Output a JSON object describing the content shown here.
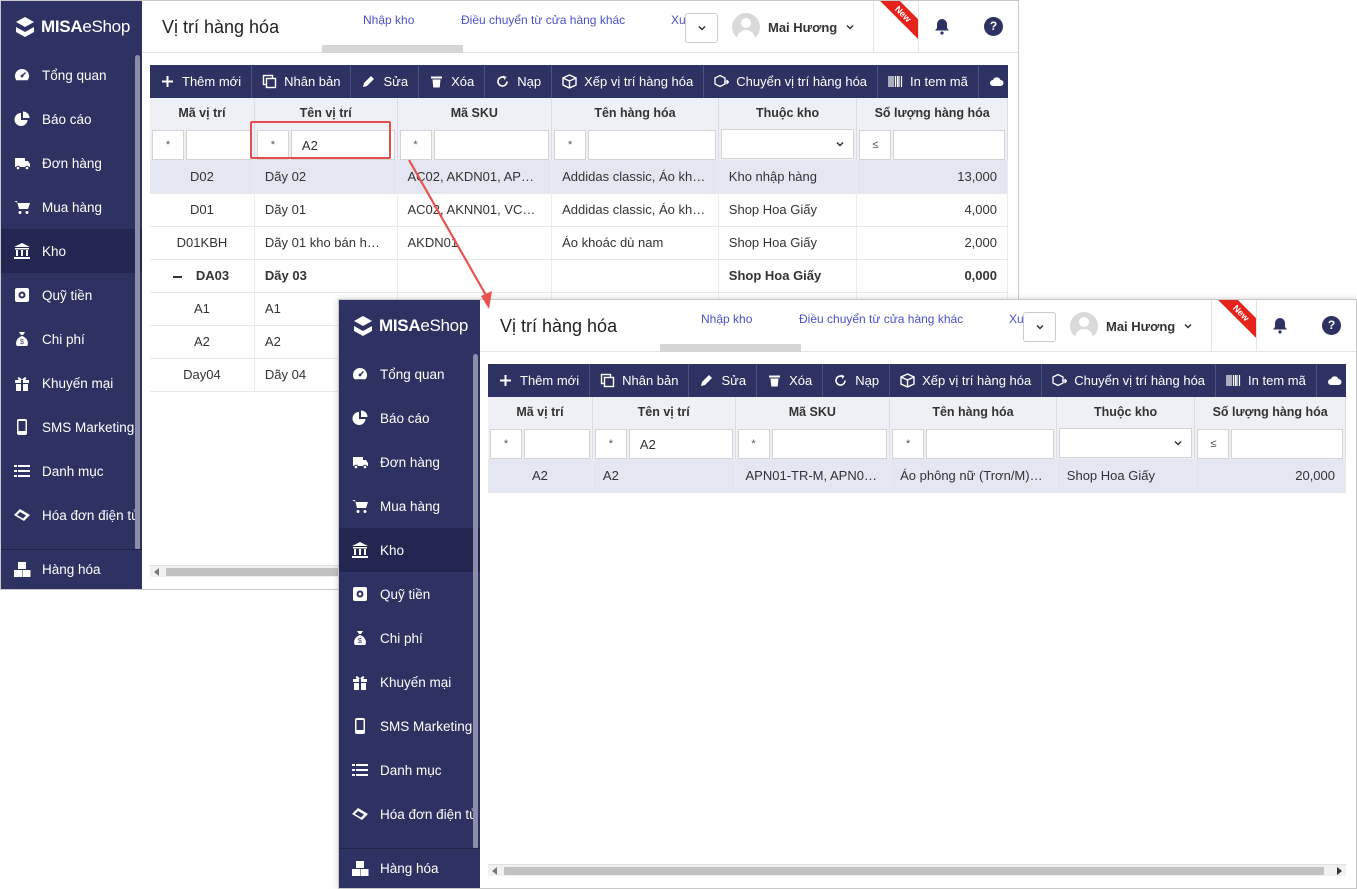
{
  "brand": {
    "bold": "MISA",
    "light": "eShop"
  },
  "sidebar": {
    "items": [
      {
        "label": "Tổng quan",
        "icon": "dashboard-icon"
      },
      {
        "label": "Báo cáo",
        "icon": "pie-chart-icon"
      },
      {
        "label": "Đơn hàng",
        "icon": "truck-icon"
      },
      {
        "label": "Mua hàng",
        "icon": "cart-icon"
      },
      {
        "label": "Kho",
        "icon": "warehouse-icon"
      },
      {
        "label": "Quỹ tiền",
        "icon": "safe-icon"
      },
      {
        "label": "Chi phí",
        "icon": "money-bag-icon"
      },
      {
        "label": "Khuyến mại",
        "icon": "gift-icon"
      },
      {
        "label": "SMS Marketing",
        "icon": "phone-icon"
      },
      {
        "label": "Danh mục",
        "icon": "list-icon"
      },
      {
        "label": "Hóa đơn điện tử",
        "icon": "invoice-icon"
      }
    ],
    "active": "Kho",
    "bottom": {
      "label": "Hàng hóa",
      "icon": "boxes-icon"
    }
  },
  "header": {
    "title": "Vị trí hàng hóa",
    "tabs": [
      "Nhập kho",
      "Điều chuyển từ cửa hàng khác",
      "Xu"
    ],
    "user": "Mai Hương",
    "new_badge": "New",
    "help": "?"
  },
  "toolbar": [
    {
      "label": "Thêm mới",
      "icon": "plus-icon"
    },
    {
      "label": "Nhân bản",
      "icon": "copy-icon"
    },
    {
      "label": "Sửa",
      "icon": "pencil-icon"
    },
    {
      "label": "Xóa",
      "icon": "trash-icon"
    },
    {
      "label": "Nạp",
      "icon": "refresh-icon"
    },
    {
      "label": "Xếp vị trí hàng hóa",
      "icon": "box-icon"
    },
    {
      "label": "Chuyển vị trí hàng hóa",
      "icon": "box-move-icon"
    },
    {
      "label": "In tem mã",
      "icon": "barcode-icon"
    },
    {
      "label": "",
      "icon": "cloud-upload-icon"
    }
  ],
  "columns": [
    "Mã vị trí",
    "Tên vị trí",
    "Mã SKU",
    "Tên hàng hóa",
    "Thuộc kho",
    "Số lượng hàng hóa"
  ],
  "filter_ops": {
    "text": "*",
    "number": "≤"
  },
  "window1": {
    "filter_ten_vi_tri": "A2",
    "rows": [
      {
        "ma": "D02",
        "ten": "Dãy 02",
        "sku": "AC02, AKDN01, APFS...",
        "hang": "Addidas classic, Áo kho...",
        "kho": "Kho nhập hàng",
        "sl": "13,000"
      },
      {
        "ma": "D01",
        "ten": "Dãy 01",
        "sku": "AC02, AKNN01, VCB01",
        "hang": "Addidas classic, Áo kho...",
        "kho": "Shop Hoa Giấy",
        "sl": "4,000"
      },
      {
        "ma": "D01KBH",
        "ten": "Dãy 01 kho bán hàng",
        "sku": "AKDN01",
        "hang": "Áo khoác dù nam",
        "kho": "Shop Hoa Giấy",
        "sl": "2,000"
      },
      {
        "ma": "DA03",
        "ten": "Dãy 03",
        "sku": "",
        "hang": "",
        "kho": "Shop Hoa Giấy",
        "sl": "0,000"
      },
      {
        "ma": "A1",
        "ten": "A1",
        "sku": "",
        "hang": "",
        "kho": "",
        "sl": ""
      },
      {
        "ma": "A2",
        "ten": "A2",
        "sku": "",
        "hang": "",
        "kho": "",
        "sl": ""
      },
      {
        "ma": "Day04",
        "ten": "Dãy 04",
        "sku": "",
        "hang": "",
        "kho": "",
        "sl": ""
      }
    ]
  },
  "window2": {
    "filter_ten_vi_tri": "A2",
    "rows": [
      {
        "ma": "A2",
        "ten": "A2",
        "sku": "APN01-TR-M, APN01...",
        "hang": "Áo phông nữ (Trơn/M), ...",
        "kho": "Shop Hoa Giấy",
        "sl": "20,000"
      }
    ]
  },
  "colors": {
    "sidebar": "#2d3262",
    "link": "#4a52c8",
    "highlight": "#e44b4b",
    "new_badge": "#e6231b"
  }
}
